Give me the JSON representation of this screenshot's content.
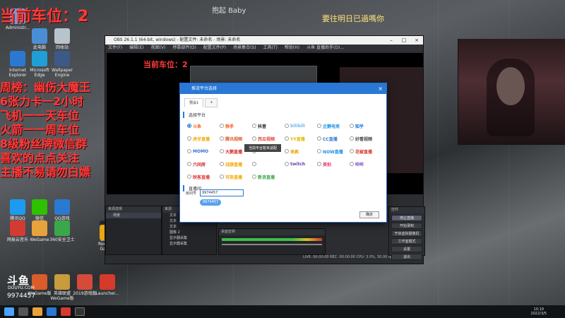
{
  "top_center_text": "抱起 Baby",
  "top_right_text": "要往明日已過嗎你",
  "overlay": {
    "queue_line": "当前车位：2",
    "inner_queue_line": "当前车位：2",
    "lines": [
      "周榜：幽伤大魔王",
      "6张力卡一2小时",
      "飞机一一天车位",
      "火箭一一周车位",
      "8级粉丝牌微信群",
      "喜欢的点点关注",
      "主播不易请勿白嫖"
    ]
  },
  "desktop_icons": [
    {
      "label": "Administr...",
      "color": "#6aa0d8"
    },
    {
      "label": "此电脑",
      "color": "#4a8fd6"
    },
    {
      "label": "回收站",
      "color": "#b8c4cc"
    },
    {
      "label": "Internet Explorer",
      "color": "#2b78d0"
    },
    {
      "label": "Microsoft Edge",
      "color": "#1f9fd6"
    },
    {
      "label": "Wallpaper Engine",
      "color": "#3c5a88"
    },
    {
      "label": "网易云音乐",
      "color": "#d33a31"
    },
    {
      "label": "WeGame",
      "color": "#e8a23a"
    },
    {
      "label": "Steam",
      "color": "#1b2838"
    },
    {
      "label": "360安全卫士",
      "color": "#3aa84a"
    },
    {
      "label": "Rockstar Games",
      "color": "#e7a613"
    },
    {
      "label": "腾讯QQ",
      "color": "#1d9bf0"
    },
    {
      "label": "微信",
      "color": "#2dc100"
    },
    {
      "label": "QQ游戏",
      "color": "#2a7ad1"
    },
    {
      "label": "WeGame版",
      "color": "#d95c2a"
    },
    {
      "label": "英雄联盟 WeGame版",
      "color": "#c89b3c"
    },
    {
      "label": "2019游戏版",
      "color": "#d64a3a"
    },
    {
      "label": "Launcher...",
      "color": "#d53a2a"
    }
  ],
  "obs": {
    "window_title": "OBS 26.1.1 (64-bit, windows) - 配置文件: 未命名 - 场景: 未命名",
    "menu": [
      "文件(F)",
      "编辑(E)",
      "视图(V)",
      "停靠部件(D)",
      "配置文件(P)",
      "场景集合(S)",
      "工具(T)",
      "帮助(H)",
      "斗鱼 直播助手(D)..."
    ],
    "scene_panel": "来源选择",
    "scene_item": "场景",
    "sources_panel": "来源",
    "sources": [
      "文本",
      "文本",
      "文本",
      "图像 2",
      "显示器采集",
      "显示器采集"
    ],
    "mixer_label": "桌面音频",
    "controls_panel": "控件",
    "controls": [
      "停止直播",
      "开始录制",
      "开启虚拟摄像机",
      "工作室模式",
      "设置",
      "退出"
    ],
    "status": "LIVE: 00:00:00  REC: 00:00:00  CPU: 3.0%, 30.00 fps",
    "obs_logo": "斗鱼"
  },
  "dialog": {
    "title": "推流平台选择",
    "close": "×",
    "tabs": [
      "预设1",
      "+"
    ],
    "section_platform": "选择平台",
    "platforms": [
      {
        "name": "斗鱼",
        "color": "#f36f21",
        "selected": true
      },
      {
        "name": "快手",
        "color": "#ff4906",
        "selected": false
      },
      {
        "name": "抖音",
        "color": "#111111",
        "selected": false
      },
      {
        "name": "bilibili",
        "color": "#6fb5f0",
        "selected": false
      },
      {
        "name": "企鹅电竞",
        "color": "#1a90e8",
        "selected": false
      },
      {
        "name": "知乎",
        "color": "#0a6de2",
        "selected": false
      },
      {
        "name": "虎牙直播",
        "color": "#f2a900",
        "selected": false
      },
      {
        "name": "腾讯视频",
        "color": "#e05a2a",
        "selected": false
      },
      {
        "name": "西瓜视频",
        "color": "#e0463a",
        "selected": false
      },
      {
        "name": "YY直播",
        "color": "#e8b600",
        "selected": false
      },
      {
        "name": "CC直播",
        "color": "#2f7bd6",
        "selected": false
      },
      {
        "name": "好看视频",
        "color": "#444444",
        "selected": false
      },
      {
        "name": "MOMO",
        "color": "#3a6fd0",
        "selected": false
      },
      {
        "name": "大鹅直播",
        "color": "#d22b2b",
        "selected": false
      },
      {
        "name": "",
        "color": "#999999",
        "selected": false
      },
      {
        "name": "来疯",
        "color": "#e8a100",
        "selected": false
      },
      {
        "name": "NOW直播",
        "color": "#1a8fe8",
        "selected": false
      },
      {
        "name": "花椒直播",
        "color": "#d23a2a",
        "selected": false
      },
      {
        "name": "六间房",
        "color": "#cc2a2a",
        "selected": false
      },
      {
        "name": "战旗直播",
        "color": "#f2a900",
        "selected": false
      },
      {
        "name": "",
        "color": "#999999",
        "selected": false
      },
      {
        "name": "twitch",
        "color": "#6441a5",
        "selected": false
      },
      {
        "name": "美拍",
        "color": "#e8347a",
        "selected": false
      },
      {
        "name": "哔哔",
        "color": "#7a54d6",
        "selected": false
      },
      {
        "name": "映客直播",
        "color": "#e03a3a",
        "selected": false
      },
      {
        "name": "可热直播",
        "color": "#f2a900",
        "selected": false
      },
      {
        "name": "新浪直播",
        "color": "#3aa84a",
        "selected": false
      }
    ],
    "tooltip": "当前平台暂未适配",
    "section_room": "直播间",
    "room_label": "房间号",
    "room_value": "9974457",
    "room_chip": "9974457",
    "confirm": "确定"
  },
  "branding": {
    "logo": "斗鱼",
    "sub": "DOUYU.COM",
    "room_number": "9974457"
  },
  "clock": {
    "time": "10:19",
    "date": "2022/3/5"
  }
}
